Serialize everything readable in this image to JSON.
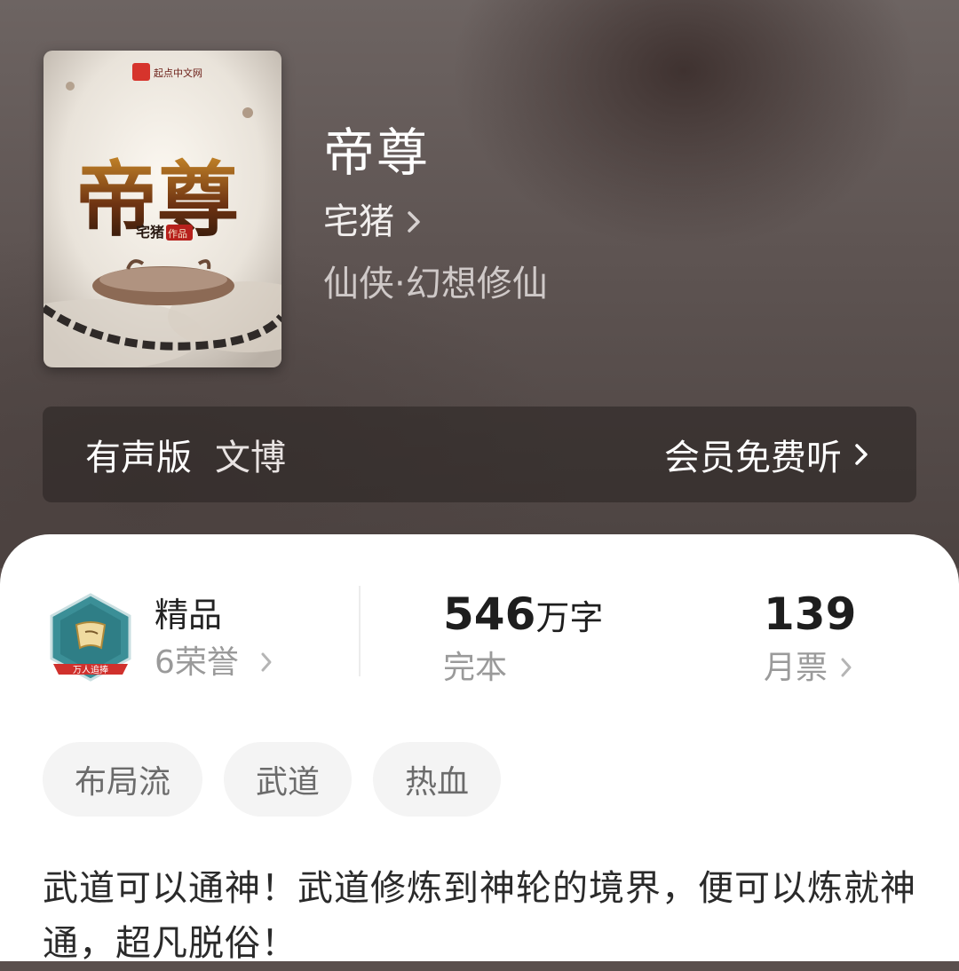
{
  "book": {
    "title": "帝尊",
    "author": "宅猪",
    "genre": "仙侠·幻想修仙",
    "cover": {
      "publisher_logo_text": "起点中文网",
      "title_art": "帝尊",
      "author_art": "宅猪",
      "author_suffix_art": "作品"
    }
  },
  "audio": {
    "label": "有声版",
    "narrator": "文博",
    "action": "会员免费听"
  },
  "stats": {
    "honor_title": "精品",
    "honor_count": "6荣誉",
    "badge_text": "万人追捧",
    "word_count_number": "546",
    "word_count_unit": "万字",
    "status": "完本",
    "monthly_tickets": "139",
    "monthly_tickets_label": "月票"
  },
  "tags": [
    "布局流",
    "武道",
    "热血"
  ],
  "synopsis": "武道可以通神！武道修炼到神轮的境界，便可以炼就神通，超凡脱俗！",
  "colors": {
    "hero_background": "#5e5452",
    "sheet_background": "#ffffff",
    "badge_teal": "#2f7e86",
    "badge_ribbon": "#d0312d",
    "tag_background": "#f4f4f4"
  },
  "icons": {
    "author_link": "chevron-right-icon",
    "audio_link": "chevron-right-icon",
    "honor_link": "chevron-right-icon",
    "ticket_link": "chevron-right-icon",
    "badge": "honor-badge-icon"
  }
}
